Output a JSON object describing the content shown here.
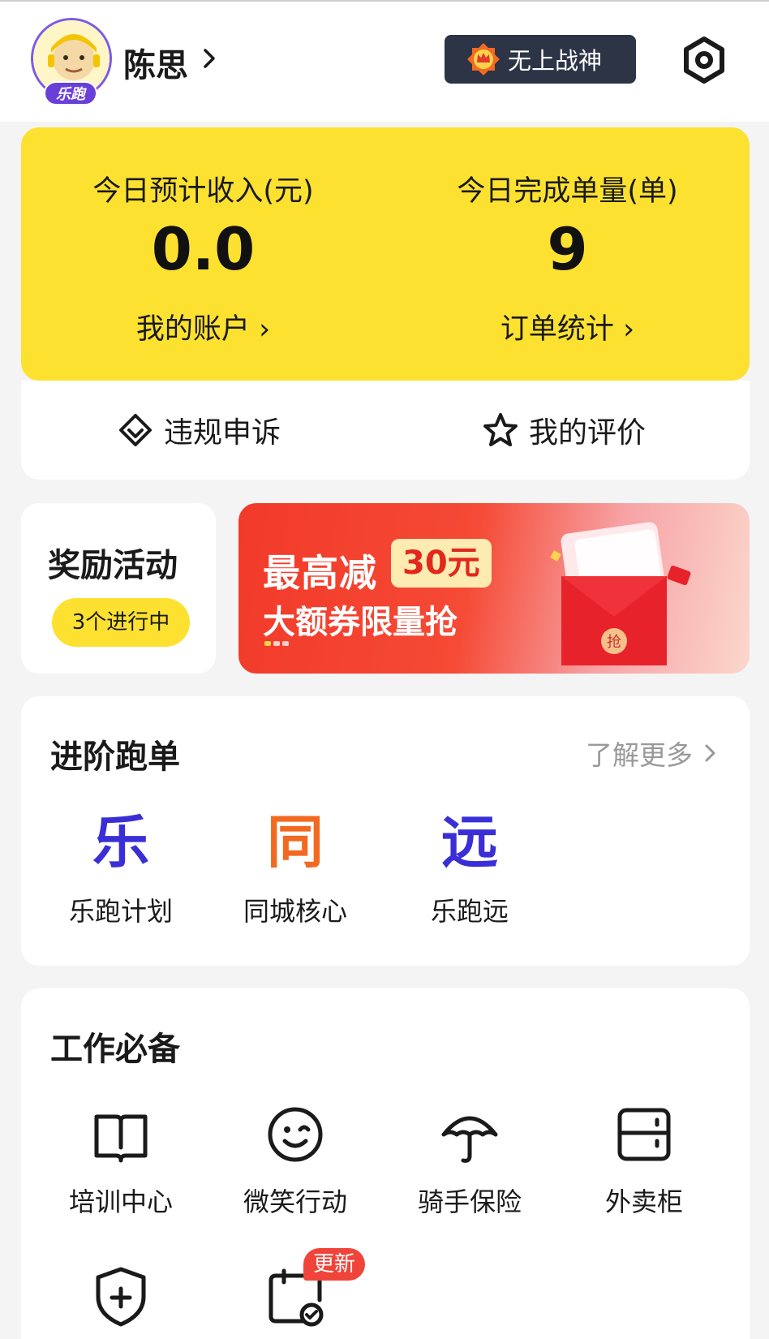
{
  "header": {
    "avatar_badge": "乐跑",
    "username": "陈思",
    "rank_title": "无上战神"
  },
  "stats": {
    "income_label": "今日预计收入(元)",
    "income_value": "0.0",
    "account_link": "我的账户",
    "orders_label": "今日完成单量(单)",
    "orders_value": "9",
    "orders_link": "订单统计"
  },
  "actions": {
    "appeal": "违规申诉",
    "reviews": "我的评价"
  },
  "rewards": {
    "title": "奖励活动",
    "status": "3个进行中"
  },
  "promo": {
    "line1": "最高减",
    "tag": "30元",
    "line2": "大额券限量抢",
    "envelope_text": "抢"
  },
  "advanced": {
    "title": "进阶跑单",
    "more": "了解更多",
    "items": [
      {
        "glyph": "乐",
        "label": "乐跑计划",
        "color": "#3a2fd6"
      },
      {
        "glyph": "同",
        "label": "同城核心",
        "color": "#f26a21"
      },
      {
        "glyph": "远",
        "label": "乐跑远",
        "color": "#3a2fd6"
      }
    ]
  },
  "work": {
    "title": "工作必备",
    "items": [
      {
        "label": "培训中心",
        "icon": "book-icon"
      },
      {
        "label": "微笑行动",
        "icon": "smile-icon"
      },
      {
        "label": "骑手保险",
        "icon": "umbrella-icon"
      },
      {
        "label": "外卖柜",
        "icon": "locker-icon"
      },
      {
        "label": "",
        "icon": "shield-plus-icon"
      },
      {
        "label": "",
        "icon": "calendar-check-icon",
        "badge": "更新"
      }
    ]
  },
  "colors": {
    "brand_yellow": "#fce131",
    "brand_purple": "#6a3fd8",
    "badge_dark": "#2c3446",
    "update_red": "#f0443a"
  }
}
